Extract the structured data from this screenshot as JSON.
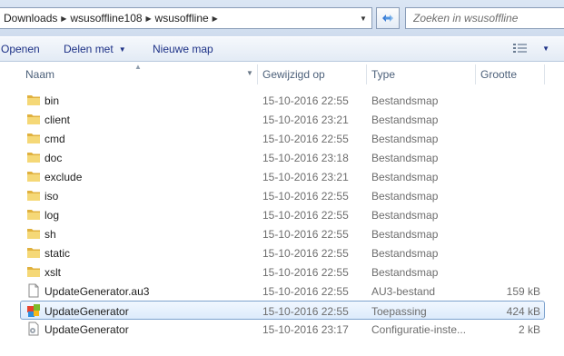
{
  "address": {
    "crumbs": [
      "Downloads",
      "wsusoffline108",
      "wsusoffline"
    ]
  },
  "search": {
    "placeholder": "Zoeken in wsusoffline"
  },
  "toolbar": {
    "open_label": "Openen",
    "share_label": "Delen met",
    "new_folder_label": "Nieuwe map"
  },
  "columns": {
    "name": "Naam",
    "modified": "Gewijzigd op",
    "type": "Type",
    "size": "Grootte"
  },
  "files": [
    {
      "name": "bin",
      "modified": "15-10-2016 22:55",
      "type": "Bestandsmap",
      "size": "",
      "icon": "folder-icon"
    },
    {
      "name": "client",
      "modified": "15-10-2016 23:21",
      "type": "Bestandsmap",
      "size": "",
      "icon": "folder-icon"
    },
    {
      "name": "cmd",
      "modified": "15-10-2016 22:55",
      "type": "Bestandsmap",
      "size": "",
      "icon": "folder-icon"
    },
    {
      "name": "doc",
      "modified": "15-10-2016 23:18",
      "type": "Bestandsmap",
      "size": "",
      "icon": "folder-icon"
    },
    {
      "name": "exclude",
      "modified": "15-10-2016 23:21",
      "type": "Bestandsmap",
      "size": "",
      "icon": "folder-icon"
    },
    {
      "name": "iso",
      "modified": "15-10-2016 22:55",
      "type": "Bestandsmap",
      "size": "",
      "icon": "folder-icon"
    },
    {
      "name": "log",
      "modified": "15-10-2016 22:55",
      "type": "Bestandsmap",
      "size": "",
      "icon": "folder-icon"
    },
    {
      "name": "sh",
      "modified": "15-10-2016 22:55",
      "type": "Bestandsmap",
      "size": "",
      "icon": "folder-icon"
    },
    {
      "name": "static",
      "modified": "15-10-2016 22:55",
      "type": "Bestandsmap",
      "size": "",
      "icon": "folder-icon"
    },
    {
      "name": "xslt",
      "modified": "15-10-2016 22:55",
      "type": "Bestandsmap",
      "size": "",
      "icon": "folder-icon"
    },
    {
      "name": "UpdateGenerator.au3",
      "modified": "15-10-2016 22:55",
      "type": "AU3-bestand",
      "size": "159 kB",
      "icon": "document-icon"
    },
    {
      "name": "UpdateGenerator",
      "modified": "15-10-2016 22:55",
      "type": "Toepassing",
      "size": "424 kB",
      "icon": "application-icon",
      "selected": true
    },
    {
      "name": "UpdateGenerator",
      "modified": "15-10-2016 23:17",
      "type": "Configuratie-inste...",
      "size": "2 kB",
      "icon": "settings-file-icon"
    }
  ],
  "colors": {
    "selection_border": "#7da2ce",
    "link_text": "#1e3287",
    "folder": "#e8c45a"
  }
}
